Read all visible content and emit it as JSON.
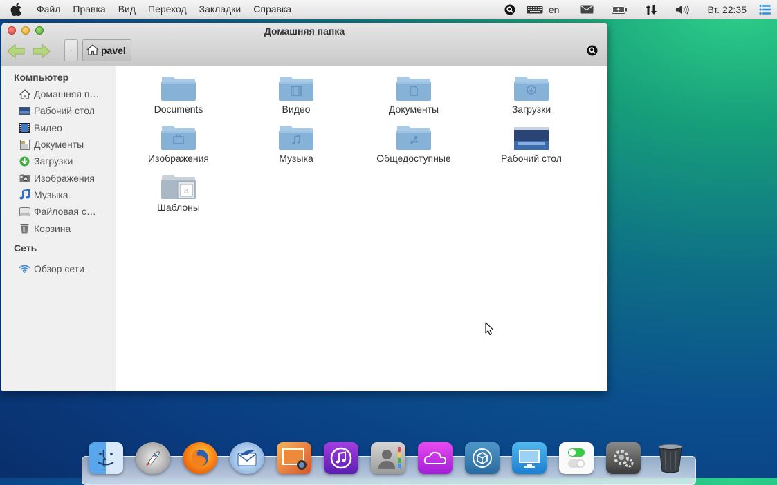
{
  "menubar": {
    "items": [
      "Файл",
      "Правка",
      "Вид",
      "Переход",
      "Закладки",
      "Справка"
    ],
    "keyboard_layout": "en",
    "clock": "Вт. 22:35"
  },
  "window": {
    "title": "Домашняя папка",
    "path_button": "pavel",
    "separator_button": "·"
  },
  "sidebar": {
    "computer_heading": "Компьютер",
    "computer_items": [
      {
        "label": "Домашняя п…",
        "icon": "home-icon"
      },
      {
        "label": "Рабочий стол",
        "icon": "desktop-icon"
      },
      {
        "label": "Видео",
        "icon": "video-icon"
      },
      {
        "label": "Документы",
        "icon": "document-icon"
      },
      {
        "label": "Загрузки",
        "icon": "download-icon"
      },
      {
        "label": "Изображения",
        "icon": "camera-icon"
      },
      {
        "label": "Музыка",
        "icon": "music-icon"
      },
      {
        "label": "Файловая с…",
        "icon": "drive-icon"
      },
      {
        "label": "Корзина",
        "icon": "trash-icon"
      }
    ],
    "network_heading": "Сеть",
    "network_items": [
      {
        "label": "Обзор сети",
        "icon": "wifi-icon"
      }
    ]
  },
  "content": {
    "items": [
      {
        "label": "Documents",
        "icon": "folder-icon"
      },
      {
        "label": "Видео",
        "icon": "video-folder-icon"
      },
      {
        "label": "Документы",
        "icon": "documents-folder-icon"
      },
      {
        "label": "Загрузки",
        "icon": "downloads-folder-icon"
      },
      {
        "label": "Изображения",
        "icon": "pictures-folder-icon"
      },
      {
        "label": "Музыка",
        "icon": "music-folder-icon"
      },
      {
        "label": "Общедоступные",
        "icon": "public-folder-icon"
      },
      {
        "label": "Рабочий стол",
        "icon": "desktop-folder-icon"
      },
      {
        "label": "Шаблоны",
        "icon": "templates-folder-icon"
      }
    ]
  },
  "dock": {
    "apps": [
      "finder-icon",
      "launchpad-icon",
      "firefox-icon",
      "thunderbird-icon",
      "photos-icon",
      "itunes-icon",
      "contacts-icon",
      "cloud-icon",
      "package-icon",
      "display-icon",
      "settings-toggle-icon",
      "system-preferences-icon",
      "trash-icon"
    ]
  },
  "colors": {
    "folder_blue": "#8ab4d8",
    "menubar_bg": "#e8e8e8",
    "sidebar_bg": "#f0f0f0"
  }
}
